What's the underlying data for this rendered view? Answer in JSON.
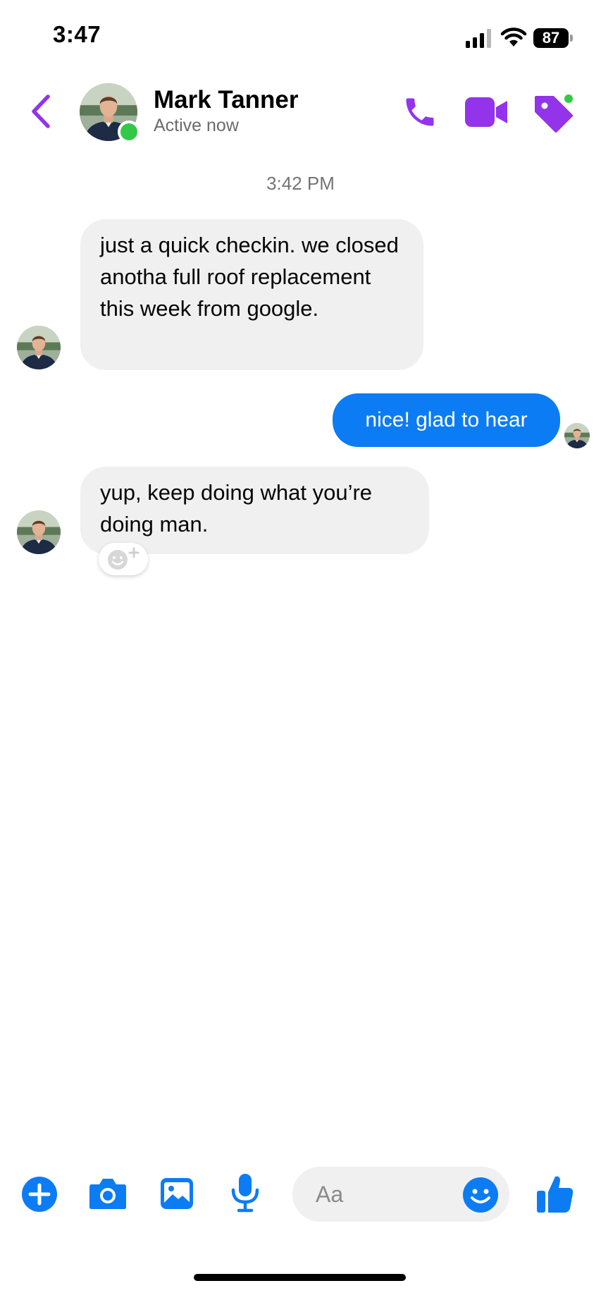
{
  "status_bar": {
    "time": "3:47",
    "battery": "87"
  },
  "header": {
    "contact_name": "Mark Tanner",
    "contact_status": "Active now",
    "icons": [
      "back-chevron-icon",
      "phone-icon",
      "video-camera-icon",
      "tag-icon"
    ]
  },
  "thread": {
    "timestamp": "3:42 PM",
    "messages": [
      {
        "from": "contact",
        "text": "just a quick checkin. we closed anotha full roof replacement this week from google."
      },
      {
        "from": "me",
        "text": "nice! glad to hear"
      },
      {
        "from": "contact",
        "text": "yup, keep doing what you’re doing man."
      }
    ]
  },
  "composer": {
    "placeholder": "Aa",
    "icons": [
      "plus-icon",
      "camera-icon",
      "gallery-icon",
      "microphone-icon",
      "emoji-icon",
      "thumbs-up-icon"
    ]
  },
  "colors": {
    "accent_purple": "#9333ea",
    "messenger_blue": "#0b7cf4",
    "online_green": "#31c946",
    "bubble_gray": "#f0f0f0"
  }
}
